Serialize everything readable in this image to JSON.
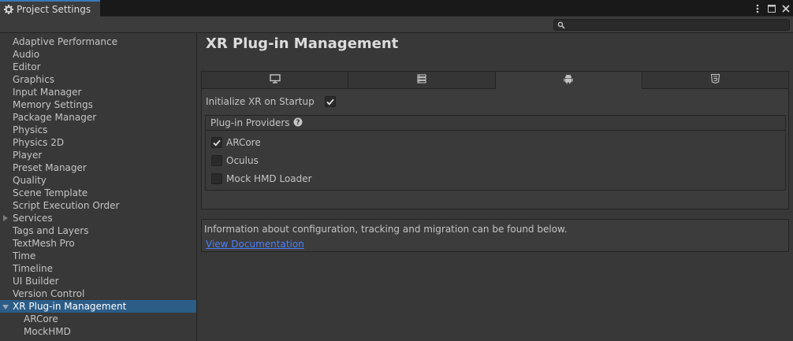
{
  "window": {
    "tab_title": "Project Settings",
    "tab_icon": "gear-icon",
    "controls": [
      "more-icon",
      "maximize-icon",
      "close-icon"
    ]
  },
  "search": {
    "value": "",
    "placeholder": ""
  },
  "sidebar": {
    "items": [
      {
        "label": "Adaptive Performance"
      },
      {
        "label": "Audio"
      },
      {
        "label": "Editor"
      },
      {
        "label": "Graphics"
      },
      {
        "label": "Input Manager"
      },
      {
        "label": "Memory Settings"
      },
      {
        "label": "Package Manager"
      },
      {
        "label": "Physics"
      },
      {
        "label": "Physics 2D"
      },
      {
        "label": "Player"
      },
      {
        "label": "Preset Manager"
      },
      {
        "label": "Quality"
      },
      {
        "label": "Scene Template"
      },
      {
        "label": "Script Execution Order"
      },
      {
        "label": "Services"
      },
      {
        "label": "Tags and Layers"
      },
      {
        "label": "TextMesh Pro"
      },
      {
        "label": "Time"
      },
      {
        "label": "Timeline"
      },
      {
        "label": "UI Builder"
      },
      {
        "label": "Version Control"
      },
      {
        "label": "XR Plug-in Management"
      },
      {
        "label": "ARCore"
      },
      {
        "label": "MockHMD"
      }
    ],
    "selected_color": "#2c5d87"
  },
  "main": {
    "title": "XR Plug-in Management",
    "platform_tabs": [
      {
        "icon": "desktop-icon",
        "active": false
      },
      {
        "icon": "server-icon",
        "active": false
      },
      {
        "icon": "android-icon",
        "active": true
      },
      {
        "icon": "html5-icon",
        "active": false
      }
    ],
    "init_label": "Initialize XR on Startup",
    "init_checked": true,
    "providers_header": "Plug-in Providers",
    "providers": [
      {
        "label": "ARCore",
        "checked": true
      },
      {
        "label": "Oculus",
        "checked": false
      },
      {
        "label": "Mock HMD Loader",
        "checked": false
      }
    ],
    "info_text": "Information about configuration, tracking and migration can be found below.",
    "doc_link": "View Documentation",
    "link_color": "#4c7eff"
  }
}
